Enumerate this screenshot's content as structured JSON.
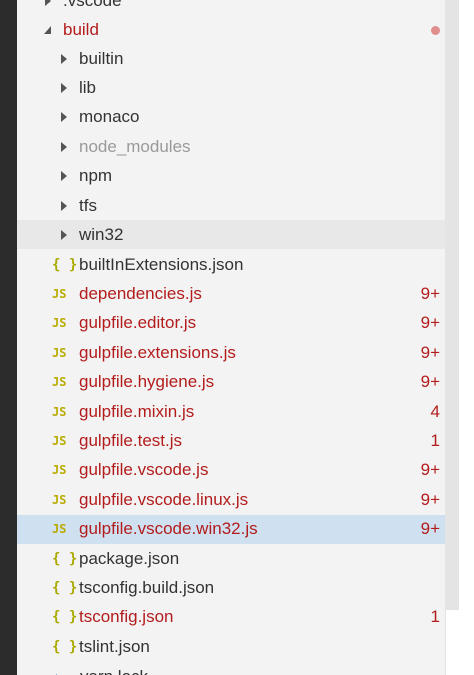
{
  "explorer": {
    "top_partial": ".vscode",
    "build_folder": "build",
    "folders": [
      {
        "label": "builtin",
        "dim": false
      },
      {
        "label": "lib",
        "dim": false
      },
      {
        "label": "monaco",
        "dim": false
      },
      {
        "label": "node_modules",
        "dim": true
      },
      {
        "label": "npm",
        "dim": false
      },
      {
        "label": "tfs",
        "dim": false
      },
      {
        "label": "win32",
        "dim": false
      }
    ],
    "files": [
      {
        "icon": "{ }",
        "label": "builtInExtensions.json",
        "badge": ""
      },
      {
        "icon": "JS",
        "label": "dependencies.js",
        "badge": "9+"
      },
      {
        "icon": "JS",
        "label": "gulpfile.editor.js",
        "badge": "9+"
      },
      {
        "icon": "JS",
        "label": "gulpfile.extensions.js",
        "badge": "9+"
      },
      {
        "icon": "JS",
        "label": "gulpfile.hygiene.js",
        "badge": "9+"
      },
      {
        "icon": "JS",
        "label": "gulpfile.mixin.js",
        "badge": "4"
      },
      {
        "icon": "JS",
        "label": "gulpfile.test.js",
        "badge": "1"
      },
      {
        "icon": "JS",
        "label": "gulpfile.vscode.js",
        "badge": "9+"
      },
      {
        "icon": "JS",
        "label": "gulpfile.vscode.linux.js",
        "badge": "9+"
      },
      {
        "icon": "JS",
        "label": "gulpfile.vscode.win32.js",
        "badge": "9+"
      },
      {
        "icon": "{ }",
        "label": "package.json",
        "badge": ""
      },
      {
        "icon": "{ }",
        "label": "tsconfig.build.json",
        "badge": ""
      },
      {
        "icon": "{ }",
        "label": "tsconfig.json",
        "badge": "1"
      },
      {
        "icon": "{ }",
        "label": "tslint.json",
        "badge": ""
      }
    ],
    "bottom_partial": "yarn.lock"
  },
  "colors": {
    "error": "#b31c1c",
    "selected": "#cfe0f0",
    "js_icon": "#b9ac00"
  }
}
